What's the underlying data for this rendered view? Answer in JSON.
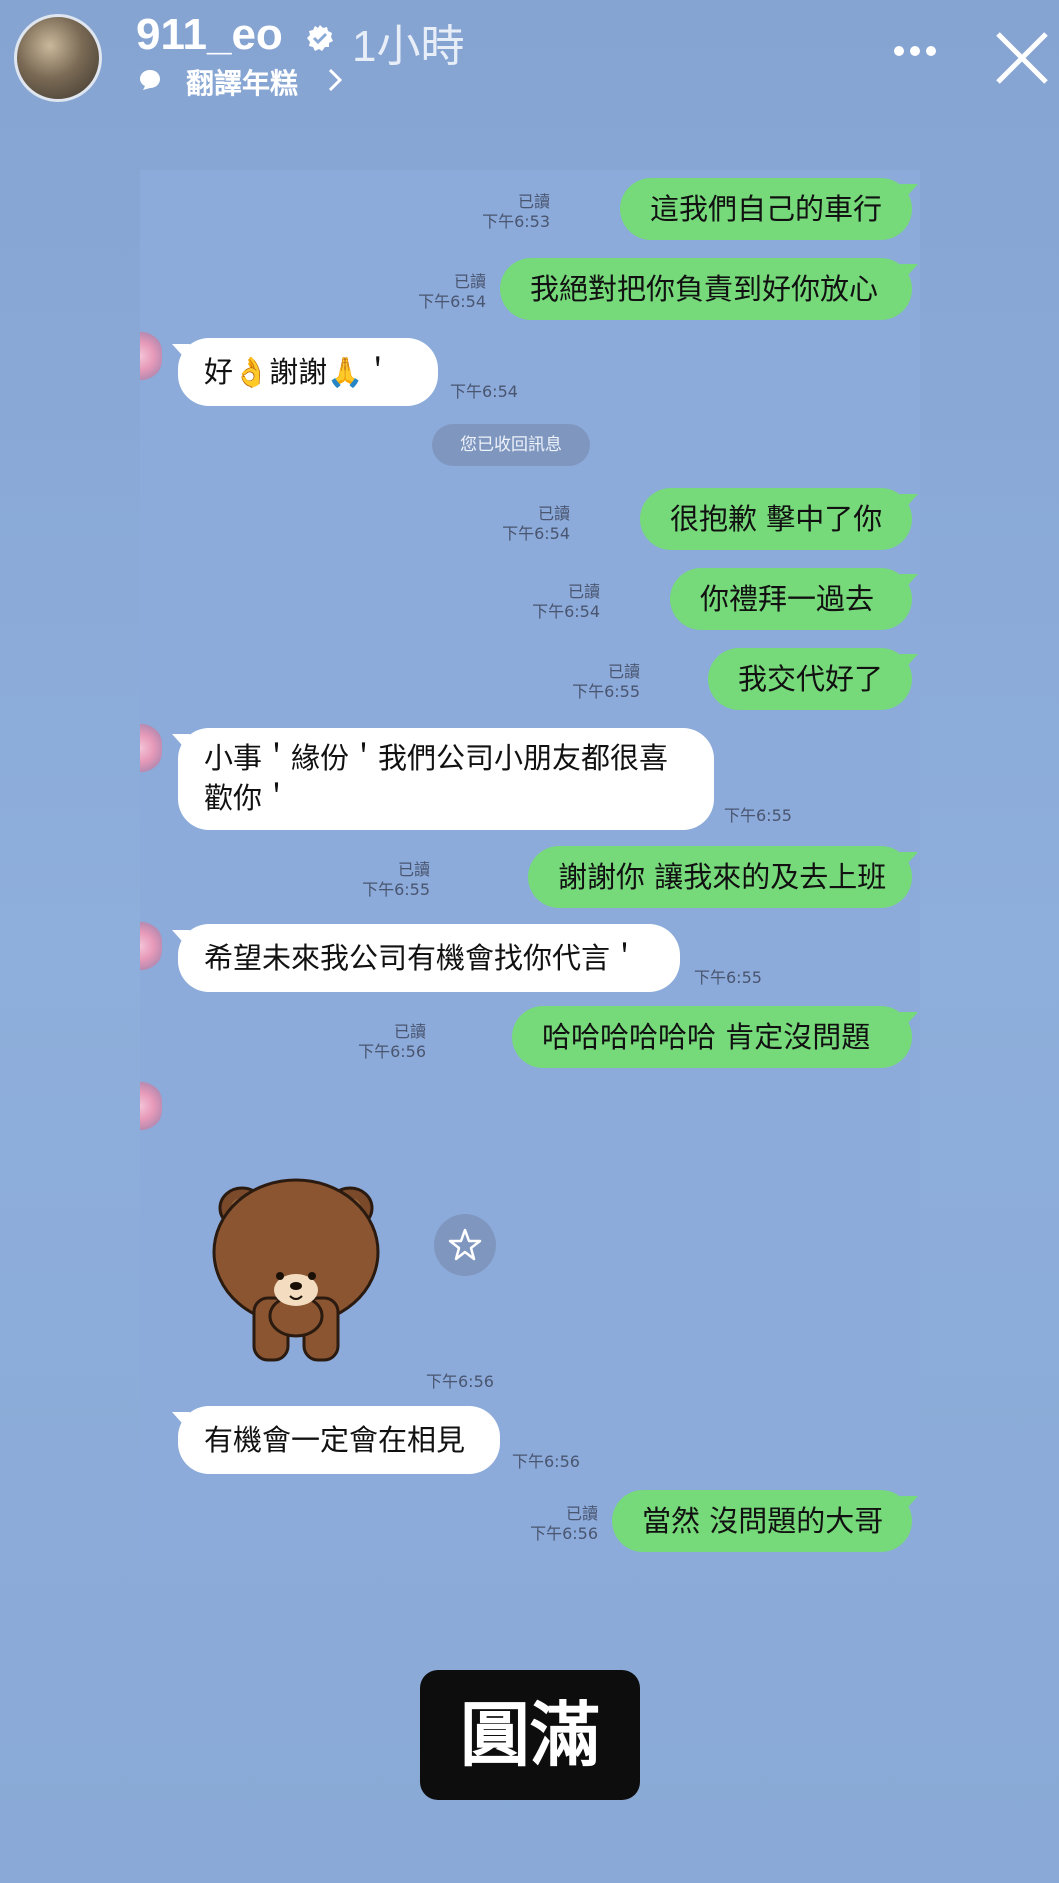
{
  "header": {
    "username": "911_eo",
    "time": "1小時",
    "subtitle": "翻譯年糕"
  },
  "chat": {
    "recall_notice": "您已收回訊息",
    "messages": [
      {
        "dir": "out",
        "text": "這我們自己的車行",
        "read": "已讀",
        "time": "下午6:53"
      },
      {
        "dir": "out",
        "text": "我絕對把你負責到好你放心",
        "read": "已讀",
        "time": "下午6:54"
      },
      {
        "dir": "in",
        "text": "好👌謝謝🙏＇",
        "time": "下午6:54"
      },
      {
        "dir": "out",
        "text": "很抱歉 擊中了你",
        "read": "已讀",
        "time": "下午6:54"
      },
      {
        "dir": "out",
        "text": "你禮拜一過去",
        "read": "已讀",
        "time": "下午6:54"
      },
      {
        "dir": "out",
        "text": "我交代好了",
        "read": "已讀",
        "time": "下午6:55"
      },
      {
        "dir": "in",
        "text_line1": "小事＇緣份＇我們公司小朋友都很喜",
        "text_line2": "歡你＇",
        "time": "下午6:55"
      },
      {
        "dir": "out",
        "text": "謝謝你 讓我來的及去上班",
        "read": "已讀",
        "time": "下午6:55"
      },
      {
        "dir": "in",
        "text": "希望未來我公司有機會找你代言＇",
        "time": "下午6:55"
      },
      {
        "dir": "out",
        "text": "哈哈哈哈哈哈 肯定沒問題",
        "read": "已讀",
        "time": "下午6:56"
      },
      {
        "dir": "in",
        "sticker": "brown-bear-bow-sticker",
        "time": "下午6:56"
      },
      {
        "dir": "in",
        "text": "有機會一定會在相見",
        "time": "下午6:56"
      },
      {
        "dir": "out",
        "text": "當然 沒問題的大哥",
        "read": "已讀",
        "time": "下午6:56"
      }
    ]
  },
  "caption": "圓滿",
  "colors": {
    "background": "#8aaad8",
    "outgoing_bubble": "#76d97a",
    "incoming_bubble": "#ffffff",
    "caption_bg": "#0d0d0d"
  }
}
